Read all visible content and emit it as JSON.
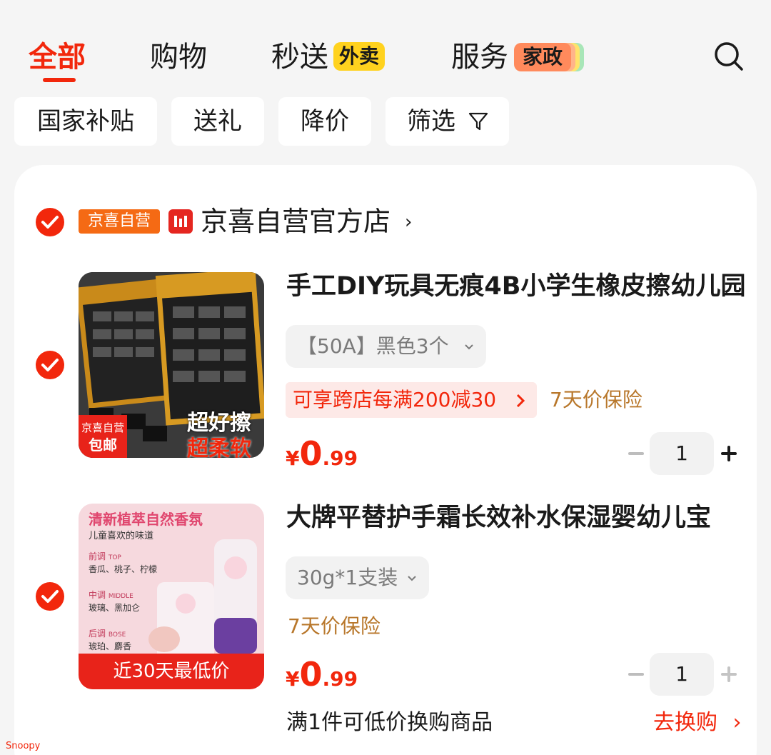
{
  "tabs": {
    "all": "全部",
    "shopping": "购物",
    "express": "秒送",
    "express_badge": "外卖",
    "service": "服务",
    "service_badge": "家政"
  },
  "filters": [
    "国家补贴",
    "送礼",
    "降价",
    "筛选"
  ],
  "store": {
    "badge": "京喜自营",
    "name": "京喜自营官方店",
    "arrow": "›"
  },
  "items": [
    {
      "title": "手工DIY玩具无痕4B小学生橡皮擦幼儿园",
      "spec": "【50A】黑色3个",
      "promo": "可享跨店每满200减30",
      "protection": "7天价保险",
      "price_symbol": "¥",
      "price_int": "0",
      "price_dec": ".99",
      "quantity": "1",
      "thumb_badge_top": "京喜自营",
      "thumb_badge_bottom": "包邮",
      "thumb_slogan_1": "超好擦",
      "thumb_slogan_2": "超柔软"
    },
    {
      "title": "大牌平替护手霜长效补水保湿婴幼儿宝",
      "spec": "30g*1支装",
      "protection": "7天价保险",
      "price_symbol": "¥",
      "price_int": "0",
      "price_dec": ".99",
      "quantity": "1",
      "thumb_headline": "清新植萃自然香氛",
      "thumb_sub": "儿童喜欢的味道",
      "thumb_notes": [
        {
          "label": "前调",
          "en": "TOP",
          "desc": "香瓜、桃子、柠檬"
        },
        {
          "label": "中调",
          "en": "MIDDLE",
          "desc": "玻璃、黑加仑"
        },
        {
          "label": "后调",
          "en": "BOSE",
          "desc": "琥珀、麝香"
        }
      ],
      "thumb_banner": "近30天最低价"
    }
  ],
  "bottom": {
    "note": "满1件可低价换购商品",
    "link": "去换购",
    "link_arrow": "›"
  },
  "watermark": "Snoopy",
  "colors": {
    "brand_red": "#f2270c",
    "protect_gold": "#b8772b",
    "store_orange": "#f56a14",
    "express_yellow": "#ffd21e"
  }
}
